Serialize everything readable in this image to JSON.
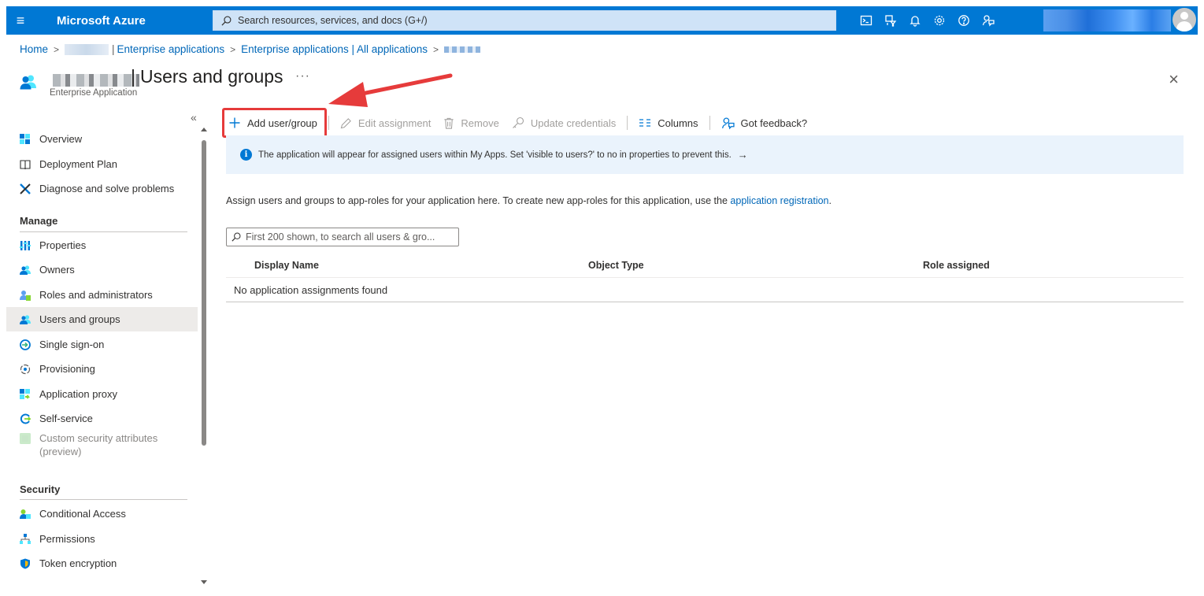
{
  "topbar": {
    "menu_icon": "hamburger-menu-icon",
    "brand": "Microsoft Azure",
    "search_placeholder": "Search resources, services, and docs (G+/)",
    "icons": [
      "cloud-shell-icon",
      "directory-filter-icon",
      "notifications-icon",
      "settings-icon",
      "help-icon",
      "feedback-icon"
    ],
    "colors": {
      "bar": "#0078d4"
    }
  },
  "breadcrumb": {
    "home": "Home",
    "enterprise_apps": "Enterprise applications",
    "all_apps": "Enterprise applications | All applications"
  },
  "header": {
    "title": "Users and groups",
    "separator": "|",
    "ellipsis": "···",
    "subtitle": "Enterprise Application",
    "close": "×"
  },
  "sidebar": {
    "collapse": "«",
    "items_top": [
      {
        "label": "Overview",
        "icon": "overview-icon"
      },
      {
        "label": "Deployment Plan",
        "icon": "book-icon"
      },
      {
        "label": "Diagnose and solve problems",
        "icon": "wrench-icon"
      }
    ],
    "manage_label": "Manage",
    "manage_items": [
      {
        "label": "Properties",
        "icon": "properties-icon"
      },
      {
        "label": "Owners",
        "icon": "owners-icon"
      },
      {
        "label": "Roles and administrators",
        "icon": "roles-icon"
      },
      {
        "label": "Users and groups",
        "icon": "users-groups-icon",
        "active": true
      },
      {
        "label": "Single sign-on",
        "icon": "sso-icon"
      },
      {
        "label": "Provisioning",
        "icon": "provisioning-icon"
      },
      {
        "label": "Application proxy",
        "icon": "app-proxy-icon"
      },
      {
        "label": "Self-service",
        "icon": "self-service-icon"
      },
      {
        "label": "Custom security attributes",
        "label2": "(preview)",
        "icon": "custom-attributes-icon",
        "disabled": true
      }
    ],
    "security_label": "Security",
    "security_items": [
      {
        "label": "Conditional Access",
        "icon": "conditional-access-icon"
      },
      {
        "label": "Permissions",
        "icon": "permissions-icon"
      },
      {
        "label": "Token encryption",
        "icon": "shield-icon"
      }
    ]
  },
  "toolbar": {
    "add": "Add user/group",
    "edit": "Edit assignment",
    "remove": "Remove",
    "update": "Update credentials",
    "columns": "Columns",
    "feedback": "Got feedback?"
  },
  "info": {
    "text": "The application will appear for assigned users within My Apps. Set 'visible to users?' to no in properties to prevent this.",
    "arrow": "→"
  },
  "assign": {
    "text": "Assign users and groups to app-roles for your application here. To create new app-roles for this application, use the ",
    "link": "application registration",
    "end": "."
  },
  "filter": {
    "placeholder": "First 200 shown, to search all users & gro..."
  },
  "table": {
    "columns": [
      "Display Name",
      "Object Type",
      "Role assigned"
    ],
    "empty": "No application assignments found"
  },
  "annotation": {
    "highlight_color": "#e63b3b"
  }
}
